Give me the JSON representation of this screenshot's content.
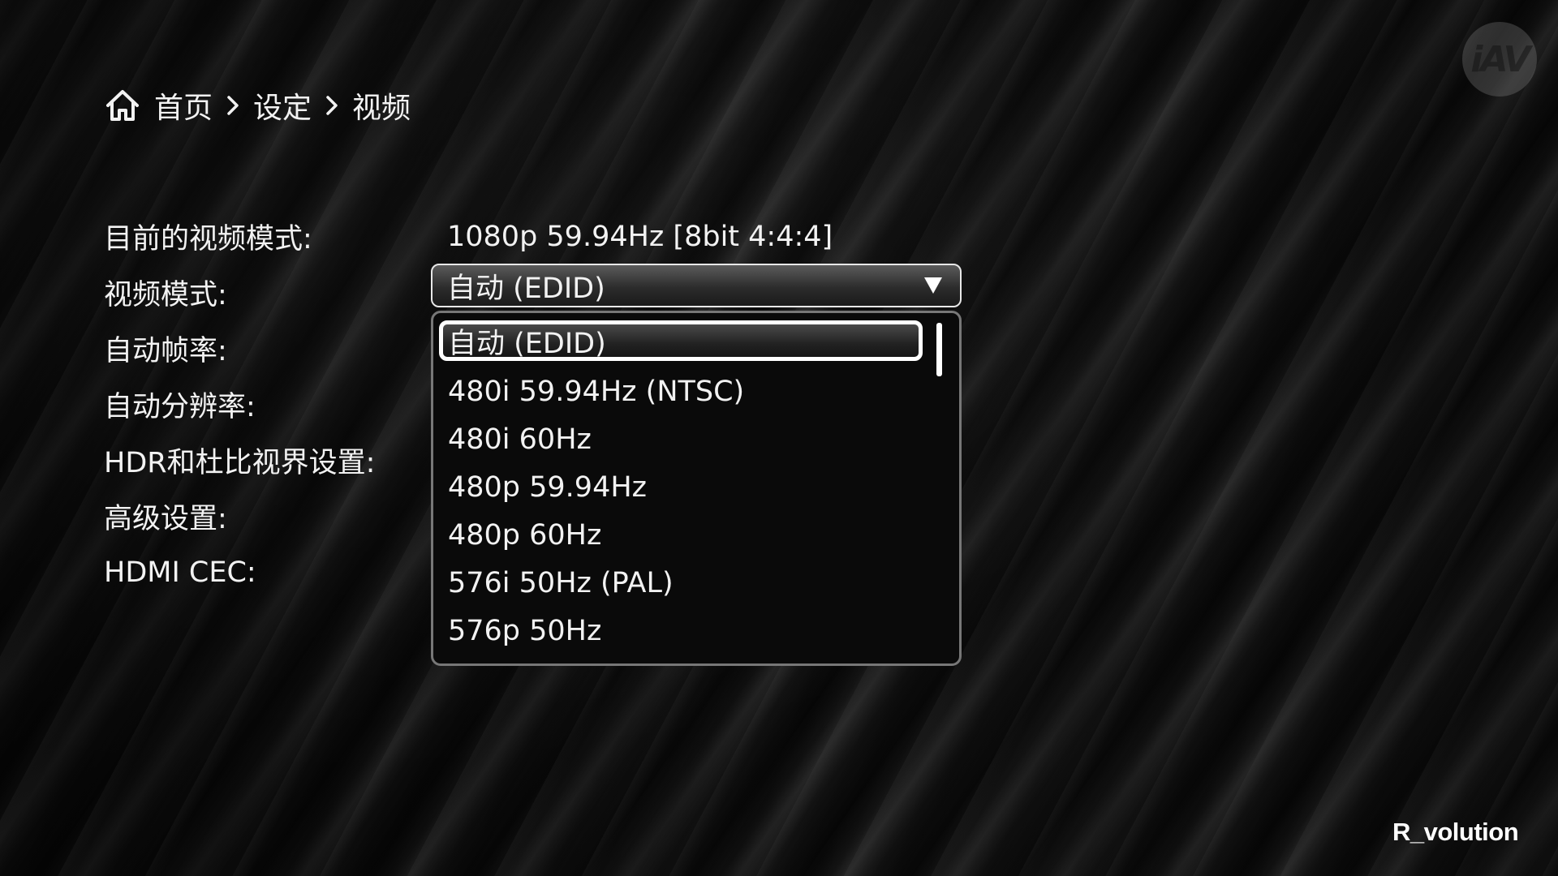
{
  "breadcrumb": {
    "icon": "home-icon",
    "items": [
      "首页",
      "设定",
      "视频"
    ],
    "separator_icon": "chevron-right-icon"
  },
  "settings": {
    "labels": [
      "目前的视频模式:",
      "视频模式:",
      "自动帧率:",
      "自动分辨率:",
      "HDR和杜比视界设置:",
      "高级设置:",
      "HDMI CEC:"
    ],
    "current_video_mode": "1080p 59.94Hz [8bit 4:4:4]"
  },
  "video_mode_select": {
    "value": "自动 (EDID)",
    "arrow_icon": "triangle-down-icon",
    "options": [
      "自动 (EDID)",
      "480i 59.94Hz (NTSC)",
      "480i 60Hz",
      "480p 59.94Hz",
      "480p 60Hz",
      "576i 50Hz (PAL)",
      "576p 50Hz"
    ],
    "highlighted_index": 0
  },
  "watermark": {
    "text": "iAV"
  },
  "brand": {
    "text": "R_volution"
  },
  "colors": {
    "background": "#0d0d0d",
    "text": "#f2f2f2",
    "highlight_border": "#ffffff"
  }
}
